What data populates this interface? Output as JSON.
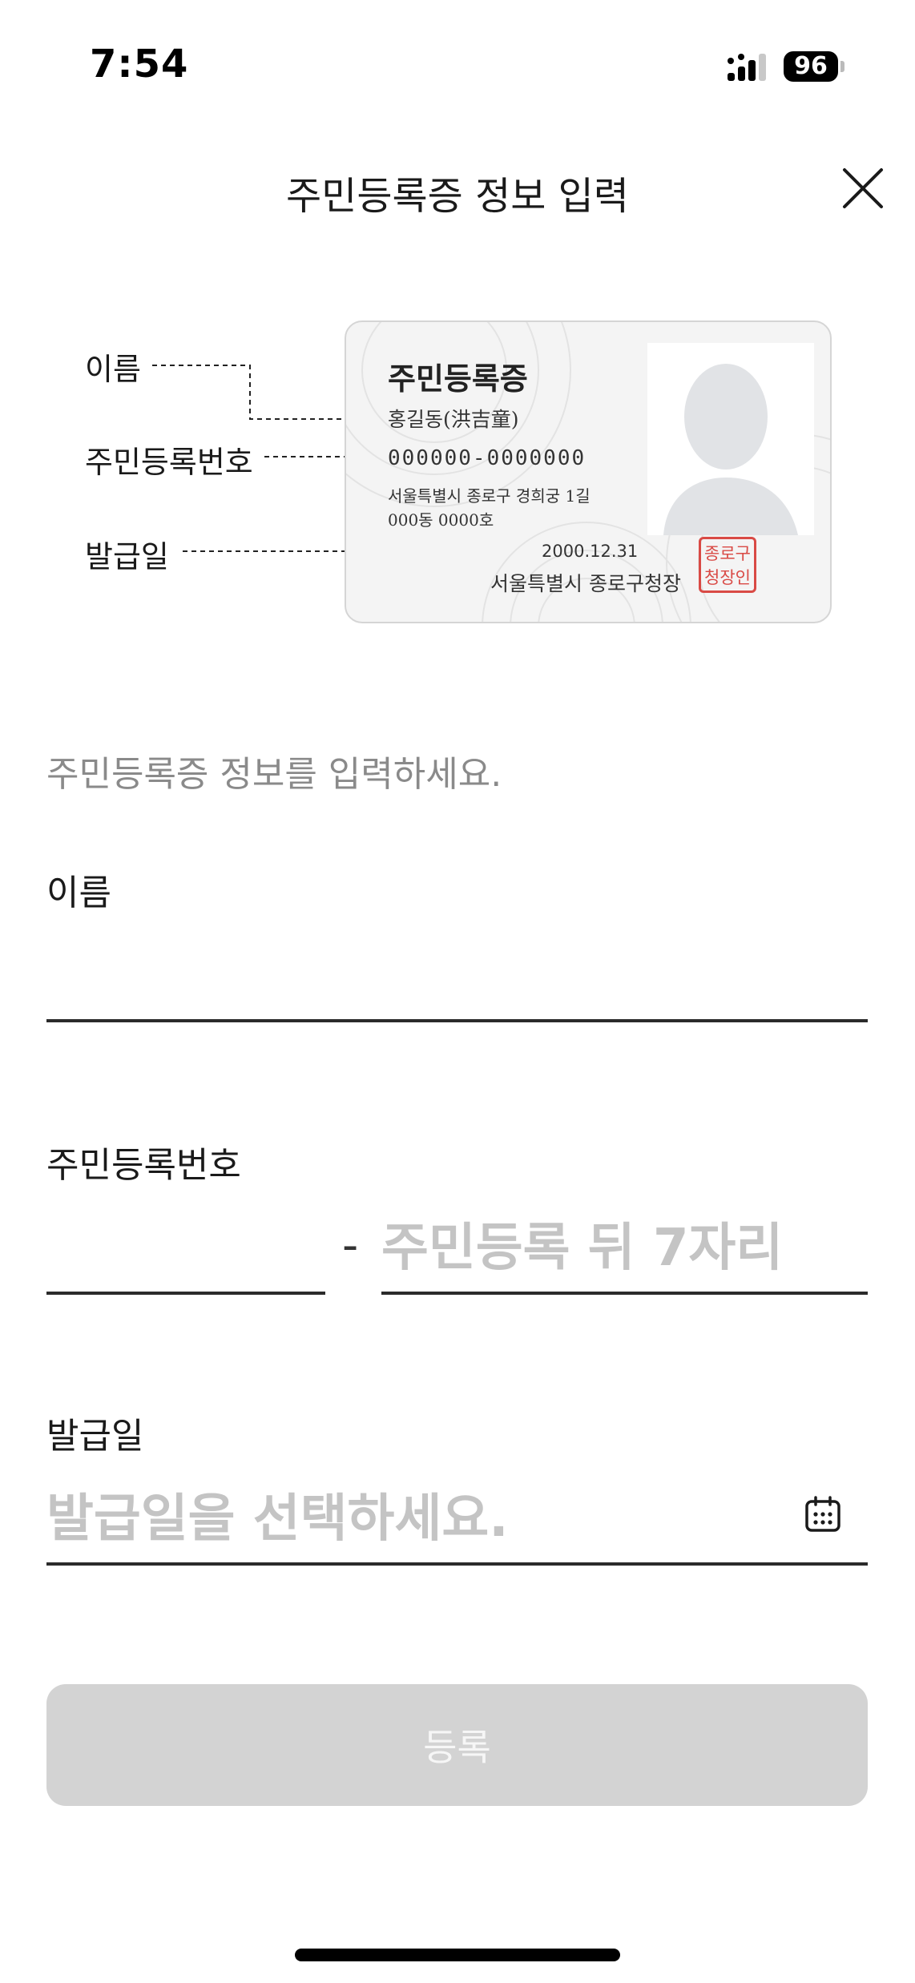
{
  "status_bar": {
    "time": "7:54",
    "battery": "96"
  },
  "header": {
    "title": "주민등록증 정보 입력"
  },
  "card_guide": {
    "labels": {
      "name": "이름",
      "number": "주민등록번호",
      "issue_date": "발급일"
    },
    "card": {
      "title": "주민등록증",
      "name": "홍길동(洪吉童)",
      "number": "000000-0000000",
      "address_line1": "서울특별시 종로구 경희궁 1길",
      "address_line2": "000동 0000호",
      "date": "2000.12.31",
      "issuer": "서울특별시 종로구청장",
      "seal_line1": "종로구",
      "seal_line2": "청장인"
    }
  },
  "form": {
    "instruction": "주민등록증 정보를 입력하세요.",
    "name": {
      "label": "이름",
      "value": "",
      "placeholder": ""
    },
    "resident_number": {
      "label": "주민등록번호",
      "front_value": "",
      "front_placeholder": "",
      "separator": "-",
      "back_value": "",
      "back_placeholder": "주민등록 뒤 7자리"
    },
    "issue_date": {
      "label": "발급일",
      "value": "",
      "placeholder": "발급일을 선택하세요."
    },
    "submit_label": "등록"
  },
  "colors": {
    "underline": "#2b2b2b",
    "placeholder": "#c4c4c4",
    "button_disabled": "#d3d3d3",
    "seal": "#d94a45"
  },
  "icons": [
    "signal-icon",
    "battery-icon",
    "close-icon",
    "id-photo-silhouette-icon",
    "calendar-icon"
  ]
}
